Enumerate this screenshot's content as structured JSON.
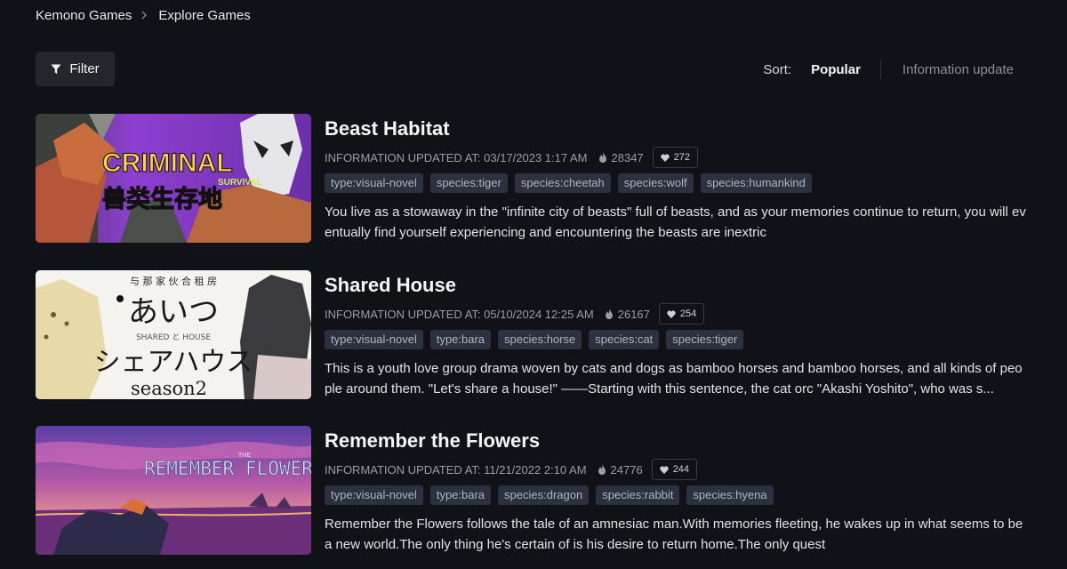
{
  "breadcrumb": {
    "home": "Kemono Games",
    "current": "Explore Games"
  },
  "filter": {
    "label": "Filter"
  },
  "sort": {
    "label": "Sort:",
    "active": "Popular",
    "other": "Information update"
  },
  "games": [
    {
      "title": "Beast Habitat",
      "updated": "INFORMATION UPDATED AT: 03/17/2023 1:17 AM",
      "views": "28347",
      "likes": "272",
      "tags": [
        "type:visual-novel",
        "species:tiger",
        "species:cheetah",
        "species:wolf",
        "species:humankind"
      ],
      "description": "You live as a stowaway in the \"infinite city of beasts\" full of beasts, and as your memories continue to return, you will eventually find yourself experiencing and encountering the beasts are inextric",
      "cover": {
        "logo": "CRIMINAL",
        "sub": "SURVIVAL",
        "kanji": "兽类生存地"
      }
    },
    {
      "title": "Shared House",
      "updated": "INFORMATION UPDATED AT: 05/10/2024 12:25 AM",
      "views": "26167",
      "likes": "254",
      "tags": [
        "type:visual-novel",
        "type:bara",
        "species:horse",
        "species:cat",
        "species:tiger"
      ],
      "description": "This is a youth love group drama woven by cats and dogs as bamboo horses and bamboo horses, and all kinds of people around them. \"Let's share a house!\" ——Starting with this sentence, the cat orc \"Akashi Yoshito\", who was s...",
      "cover": {
        "top": "与 那 家 伙 合 租 房",
        "line1": "あいつ",
        "mid": "SHARED  と  HOUSE",
        "line2": "シェアハウス",
        "season": "season2"
      }
    },
    {
      "title": "Remember the Flowers",
      "updated": "INFORMATION UPDATED AT: 11/21/2022 2:10 AM",
      "views": "24776",
      "likes": "244",
      "tags": [
        "type:visual-novel",
        "type:bara",
        "species:dragon",
        "species:rabbit",
        "species:hyena"
      ],
      "description": "Remember the Flowers follows the tale of an amnesiac man.With memories fleeting, he wakes up in what seems to be a new world.The only thing he's certain of is his desire to return home.The only quest",
      "cover": {
        "word1": "REMEMBER",
        "small": "THE",
        "word2": "FLOWERS"
      }
    }
  ],
  "colors": {
    "background": "#111218",
    "tag_bg": "#2c3140",
    "tag_text": "#aeb3c2",
    "muted": "#9b9da6"
  },
  "icons": {
    "filter": "filter-icon",
    "chevron": "chevron-right-icon",
    "views": "flame-icon",
    "likes": "heart-icon"
  }
}
